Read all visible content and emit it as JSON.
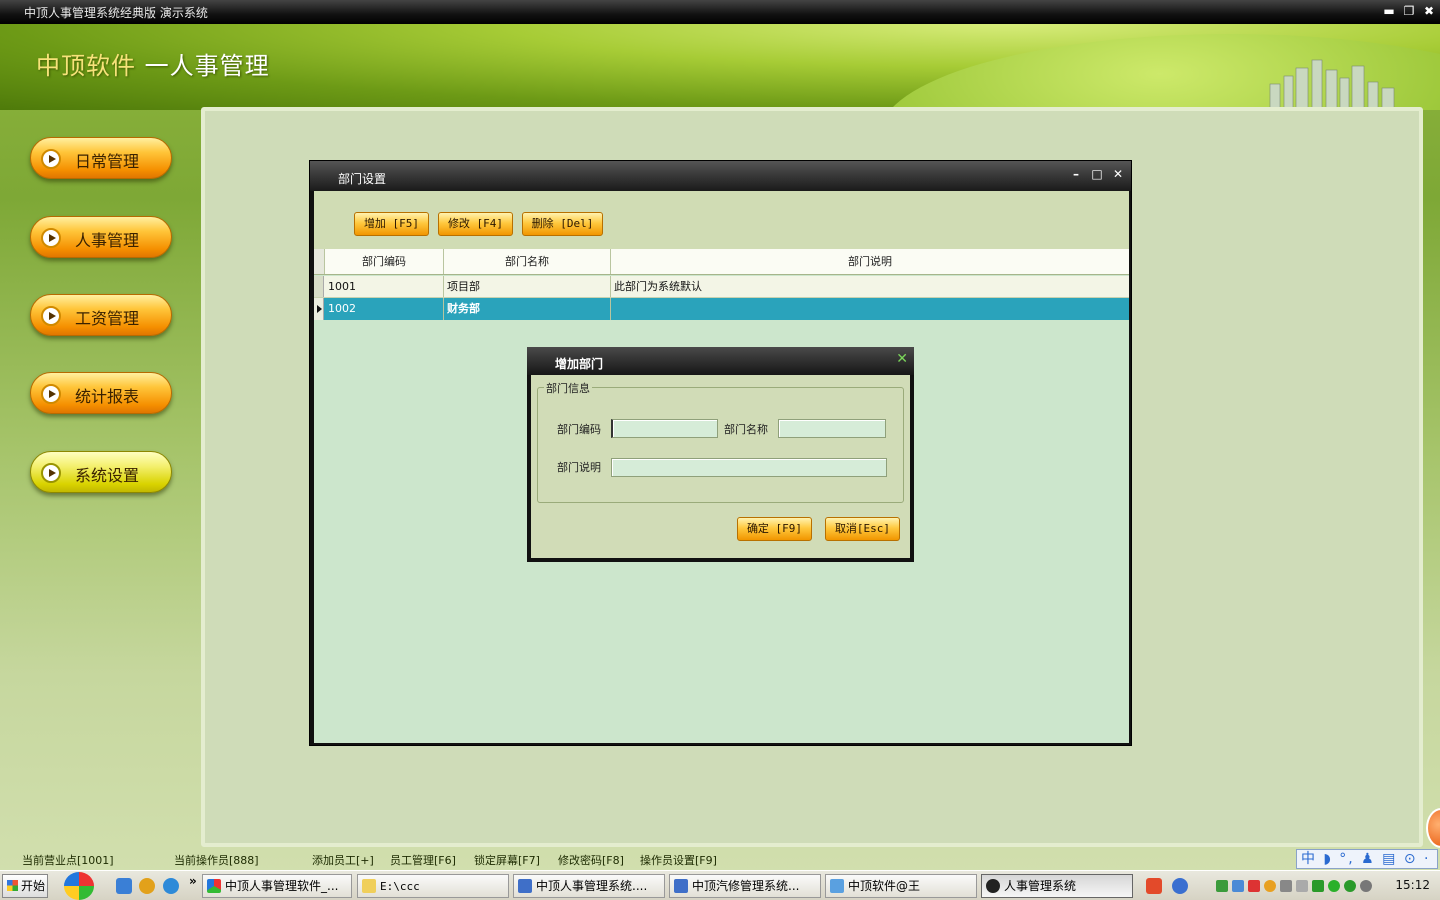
{
  "window": {
    "title": "中顶人事管理系统经典版 演示系统",
    "controls": {
      "minimize": "▬",
      "restore": "❐",
      "close": "✖"
    }
  },
  "header": {
    "brand_main": "中顶软件",
    "brand_sub": " 一人事管理"
  },
  "sidebar": {
    "items": [
      {
        "label": "日常管理",
        "icon": "play-circle-icon"
      },
      {
        "label": "人事管理",
        "icon": "play-circle-icon"
      },
      {
        "label": "工资管理",
        "icon": "play-circle-icon"
      },
      {
        "label": "统计报表",
        "icon": "play-circle-icon"
      },
      {
        "label": "系统设置",
        "icon": "play-circle-icon"
      }
    ]
  },
  "dept_window": {
    "title": "部门设置",
    "controls": {
      "minimize": "–",
      "maximize": "□",
      "close": "✕"
    },
    "toolbar": {
      "add": "增加 [F5]",
      "edit": "修改 [F4]",
      "delete": "删除 [Del]"
    },
    "grid": {
      "columns": [
        "部门编码",
        "部门名称",
        "部门说明"
      ],
      "rows": [
        {
          "code": "1001",
          "name": "项目部",
          "desc": "此部门为系统默认"
        },
        {
          "code": "1002",
          "name": "财务部",
          "desc": ""
        }
      ],
      "selected_row": 1
    }
  },
  "add_dialog": {
    "title": "增加部门",
    "close": "✕",
    "group": "部门信息",
    "fields": {
      "code_label": "部门编码",
      "name_label": "部门名称",
      "desc_label": "部门说明",
      "code_value": "",
      "name_value": "",
      "desc_value": ""
    },
    "buttons": {
      "ok": "确定 [F9]",
      "cancel": "取消[Esc]"
    }
  },
  "statusbar": {
    "site": "当前营业点[1001]",
    "operator": "当前操作员[888]",
    "add_employee": "添加员工[+]",
    "employee_mgmt": "员工管理[F6]",
    "lock_screen": "锁定屏幕[F7]",
    "change_password": "修改密码[F8]",
    "operator_settings": "操作员设置[F9]"
  },
  "ime": {
    "text": "中 ◗ °, ♟ ▤ ⊙ ·"
  },
  "taskbar": {
    "start": "开始",
    "quicklaunch_more": "»",
    "tasks": [
      "中顶人事管理软件_...",
      "E:\\ccc",
      "中顶人事管理系统....",
      "中顶汽修管理系统...",
      "中顶软件@王",
      "人事管理系统"
    ],
    "clock": "15:12"
  },
  "colors": {
    "accent_orange": "#f19600",
    "selected_row": "#2aa3bb",
    "panel": "#cfdcb8",
    "grid_bg": "#cce6cc"
  }
}
